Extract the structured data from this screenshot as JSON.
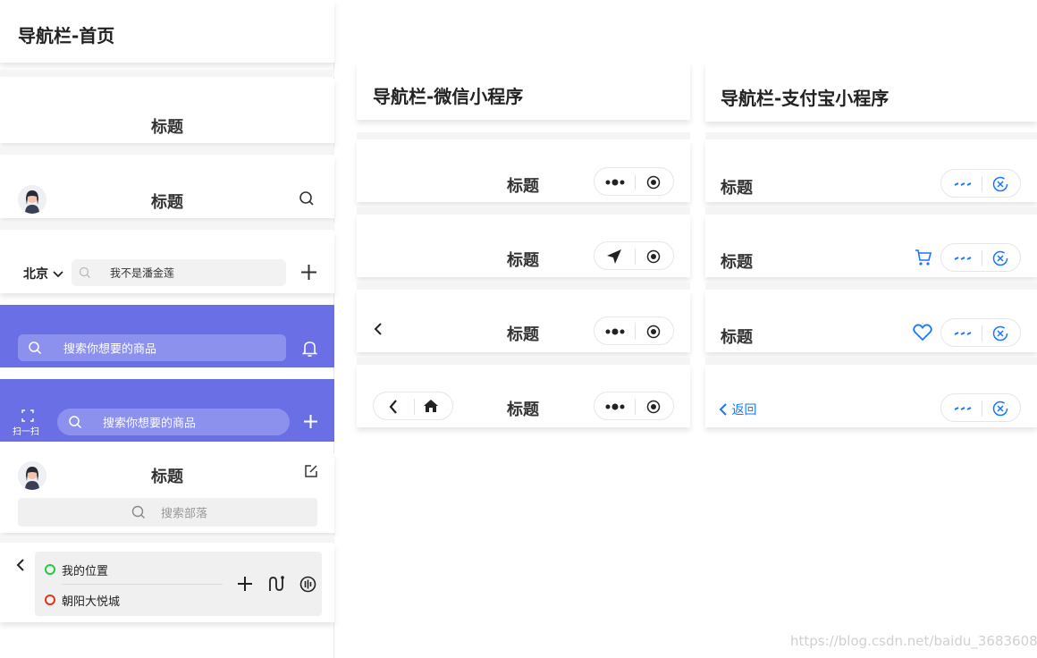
{
  "col1": {
    "heading": "导航栏-首页",
    "bar1_title": "标题",
    "bar2_title": "标题",
    "bar3": {
      "city": "北京",
      "search_placeholder": "我不是潘金莲"
    },
    "bar4": {
      "search_placeholder": "搜索你想要的商品"
    },
    "bar5": {
      "scan_label": "扫一扫",
      "search_placeholder": "搜索你想要的商品"
    },
    "bar6": {
      "title": "标题",
      "search_placeholder": "搜索部落"
    },
    "bar7": {
      "from": "我的位置",
      "to": "朝阳大悦城"
    }
  },
  "col2": {
    "heading": "导航栏-微信小程序",
    "titles": [
      "标题",
      "标题",
      "标题",
      "标题"
    ]
  },
  "col3": {
    "heading": "导航栏-支付宝小程序",
    "titles": [
      "标题",
      "标题",
      "标题"
    ],
    "back_label": "返回"
  },
  "watermark": "https://blog.csdn.net/baidu_36836080",
  "colors": {
    "purple": "#6a6fe6",
    "alipay_blue": "#1677ff",
    "green": "#22cc44",
    "red": "#e0331c"
  }
}
